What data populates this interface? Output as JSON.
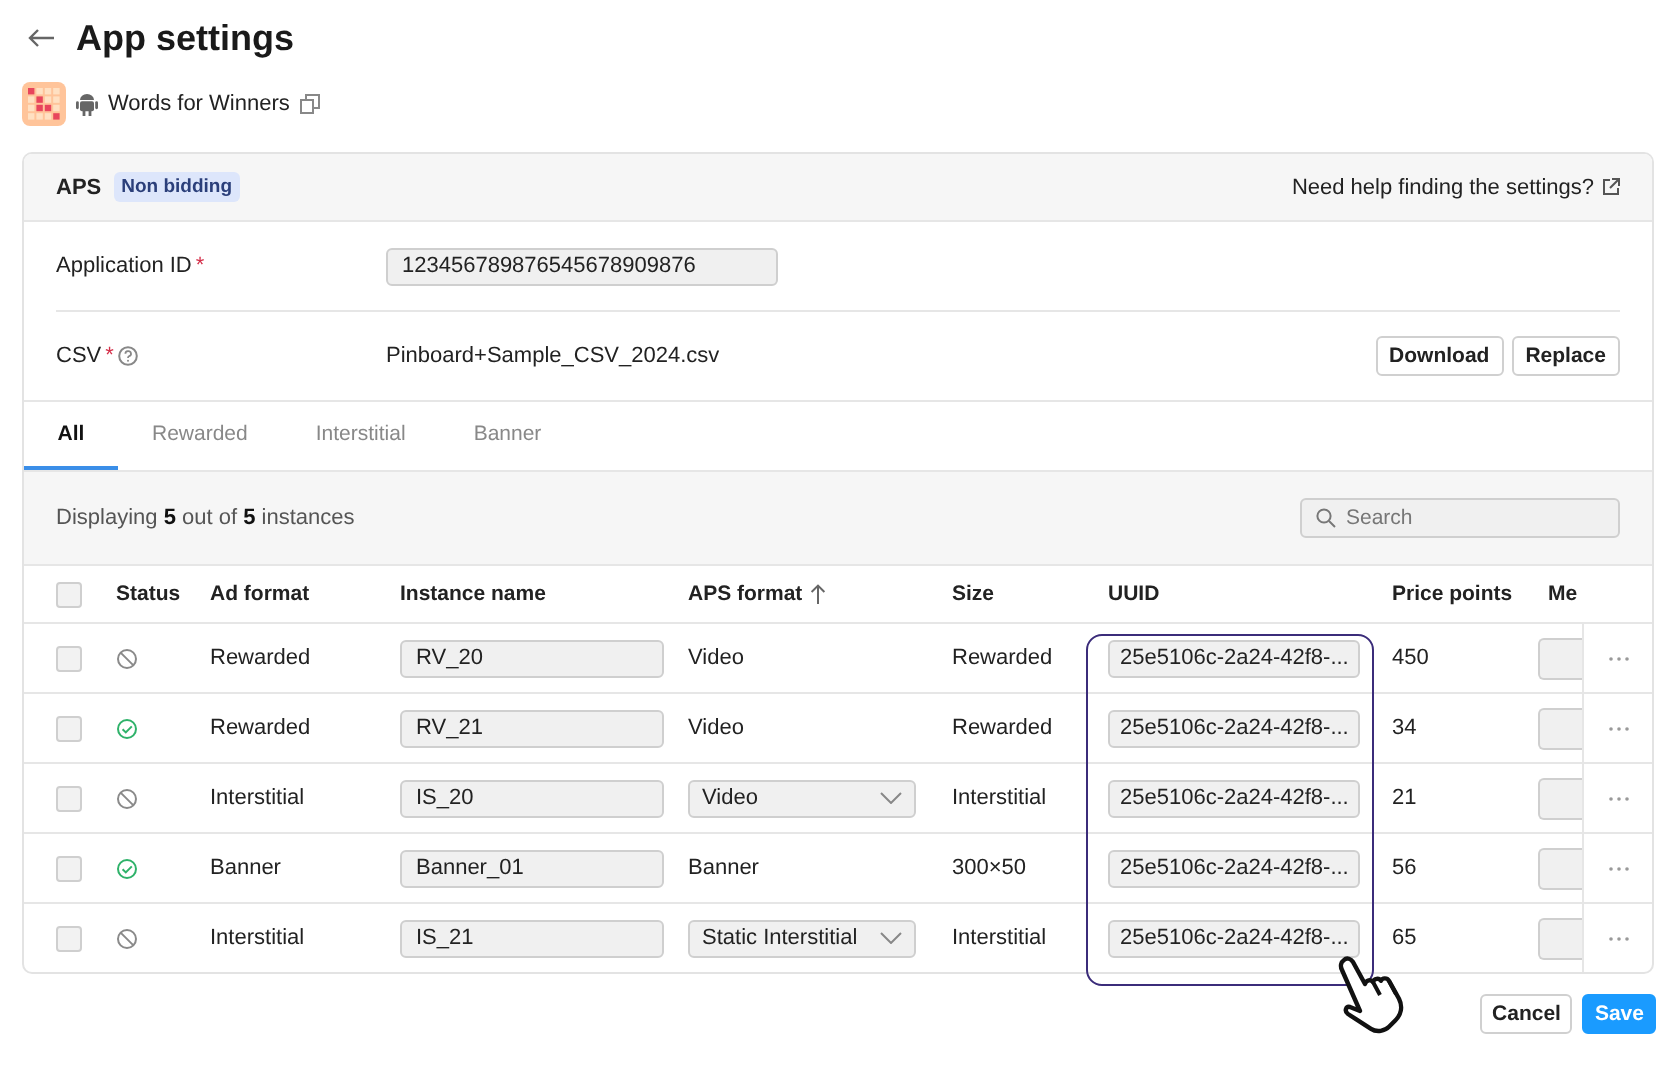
{
  "header": {
    "title": "App settings"
  },
  "app": {
    "name": "Words for Winners"
  },
  "aps": {
    "label": "APS",
    "badge": "Non bidding",
    "help_link": "Need help finding the settings?"
  },
  "fields": [
    {
      "kind": "input",
      "label": "Application ID",
      "required_mark": "*",
      "value": "123456789876545678909876"
    },
    {
      "kind": "file",
      "label": "CSV",
      "required_mark": "*",
      "value": "Pinboard+Sample_CSV_2024.csv",
      "buttons": [
        "Download",
        "Replace"
      ]
    }
  ],
  "tabs": [
    {
      "label": "All",
      "selected": true
    },
    {
      "label": "Rewarded",
      "selected": false
    },
    {
      "label": "Interstitial",
      "selected": false
    },
    {
      "label": "Banner",
      "selected": false
    }
  ],
  "toolbar": {
    "summary": "Displaying **5** out of **5** instances",
    "search": {
      "placeholder": "Search"
    }
  },
  "table": {
    "header_checked": false,
    "columns": [
      {
        "label": "Status",
        "sorted": false
      },
      {
        "label": "Ad format",
        "sorted": false
      },
      {
        "label": "Instance name",
        "sorted": false
      },
      {
        "label": "APS format",
        "sorted": true
      },
      {
        "label": "Size",
        "sorted": false
      },
      {
        "label": "UUID",
        "sorted": false
      },
      {
        "label": "Price points",
        "sorted": false
      },
      {
        "label": "Me",
        "sorted": false
      }
    ],
    "rows": [
      {
        "checked": false,
        "active": false,
        "ad_format": "Rewarded",
        "instance_name": "RV_20",
        "aps_format": {
          "kind": "text",
          "value": "Video"
        },
        "size": "Rewarded",
        "uuid": "25e5106c-2a24-42f8-...",
        "price_points": "450"
      },
      {
        "checked": false,
        "active": true,
        "ad_format": "Rewarded",
        "instance_name": "RV_21",
        "aps_format": {
          "kind": "text",
          "value": "Video"
        },
        "size": "Rewarded",
        "uuid": "25e5106c-2a24-42f8-...",
        "price_points": "34"
      },
      {
        "checked": false,
        "active": false,
        "ad_format": "Interstitial",
        "instance_name": "IS_20",
        "aps_format": {
          "kind": "select",
          "value": "Video"
        },
        "size": "Interstitial",
        "uuid": "25e5106c-2a24-42f8-...",
        "price_points": "21"
      },
      {
        "checked": false,
        "active": true,
        "ad_format": "Banner",
        "instance_name": "Banner_01",
        "aps_format": {
          "kind": "text",
          "value": "Banner"
        },
        "size": "300×50",
        "uuid": "25e5106c-2a24-42f8-...",
        "price_points": "56"
      },
      {
        "checked": false,
        "active": false,
        "ad_format": "Interstitial",
        "instance_name": "IS_21",
        "aps_format": {
          "kind": "select",
          "value": "Static Interstitial"
        },
        "size": "Interstitial",
        "uuid": "25e5106c-2a24-42f8-...",
        "price_points": "65"
      }
    ]
  },
  "actions": [
    {
      "kind": "secondary",
      "label": "Cancel"
    },
    {
      "kind": "primary",
      "label": "Save"
    }
  ]
}
